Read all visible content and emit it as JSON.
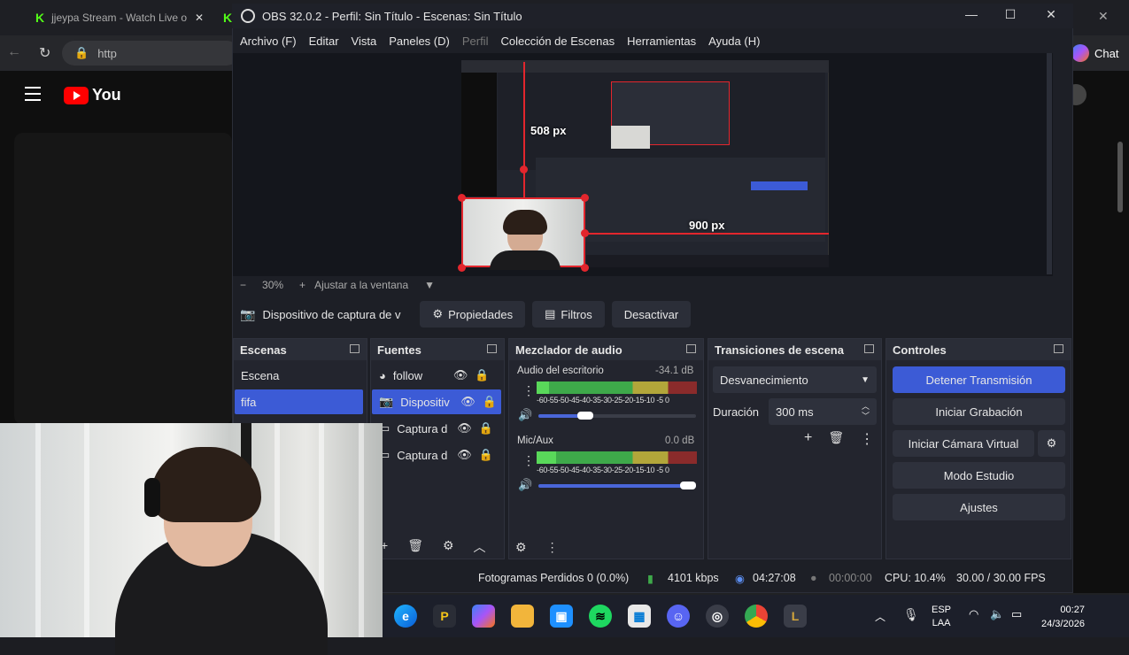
{
  "browser": {
    "tabs": [
      {
        "label": "jjeypa Stream - Watch Live o"
      },
      {
        "label": ""
      }
    ],
    "url": "http",
    "yt_logo_text": "You",
    "chat_label": "Chat"
  },
  "obs": {
    "title": "OBS 32.0.2 - Perfil: Sin Título - Escenas: Sin Título",
    "menu": [
      {
        "label": "Archivo (F)",
        "enabled": true
      },
      {
        "label": "Editar",
        "enabled": true
      },
      {
        "label": "Vista",
        "enabled": true
      },
      {
        "label": "Paneles (D)",
        "enabled": true
      },
      {
        "label": "Perfil",
        "enabled": false
      },
      {
        "label": "Colección de Escenas",
        "enabled": true
      },
      {
        "label": "Herramientas",
        "enabled": true
      },
      {
        "label": "Ayuda (H)",
        "enabled": true
      }
    ],
    "preview": {
      "height_label": "508 px",
      "width_label": "900 px"
    },
    "zoom": {
      "level": "30%",
      "fit_label": "Ajustar a la ventana"
    },
    "source_toolbar": {
      "selected_source": "Dispositivo de captura de v",
      "properties": "Propiedades",
      "filters": "Filtros",
      "deactivate": "Desactivar"
    },
    "scenes": {
      "title": "Escenas",
      "items": [
        {
          "label": "Escena",
          "selected": false
        },
        {
          "label": "fifa",
          "selected": true
        }
      ]
    },
    "sources": {
      "title": "Fuentes",
      "items": [
        {
          "label": "follow",
          "icon": "browser-icon",
          "selected": false
        },
        {
          "label": "Dispositiv",
          "icon": "camera-icon",
          "selected": true
        },
        {
          "label": "Captura d",
          "icon": "window-icon",
          "selected": false
        },
        {
          "label": "Captura d",
          "icon": "window-icon",
          "selected": false
        }
      ]
    },
    "mixer": {
      "title": "Mezclador de audio",
      "channels": [
        {
          "name": "Audio del escritorio",
          "db": "-34.1 dB",
          "level_fraction": 0.08,
          "volume_fraction": 0.35
        },
        {
          "name": "Mic/Aux",
          "db": "0.0 dB",
          "level_fraction": 0.12,
          "volume_fraction": 1.0
        }
      ],
      "scale": "-60-55-50-45-40-35-30-25-20-15-10 -5  0"
    },
    "transitions": {
      "title": "Transiciones de escena",
      "selected": "Desvanecimiento",
      "duration_label": "Duración",
      "duration_value": "300 ms"
    },
    "controls": {
      "title": "Controles",
      "stop_stream": "Detener Transmisión",
      "start_recording": "Iniciar Grabación",
      "virtual_cam": "Iniciar Cámara Virtual",
      "studio_mode": "Modo Estudio",
      "settings": "Ajustes"
    },
    "status": {
      "dropped_frames": "Fotogramas Perdidos 0 (0.0%)",
      "bitrate": "4101 kbps",
      "stream_time": "04:27:08",
      "record_time": "00:00:00",
      "cpu": "CPU: 10.4%",
      "fps": "30.00 / 30.00 FPS"
    }
  },
  "taskbar": {
    "lang": "ESP",
    "lang2": "LAA",
    "time": "00:27",
    "date": "24/3/2026"
  },
  "colors": {
    "accent_blue": "#3c5bd6",
    "selection_red": "#e3262d",
    "meter_green": "#3ea94a"
  }
}
